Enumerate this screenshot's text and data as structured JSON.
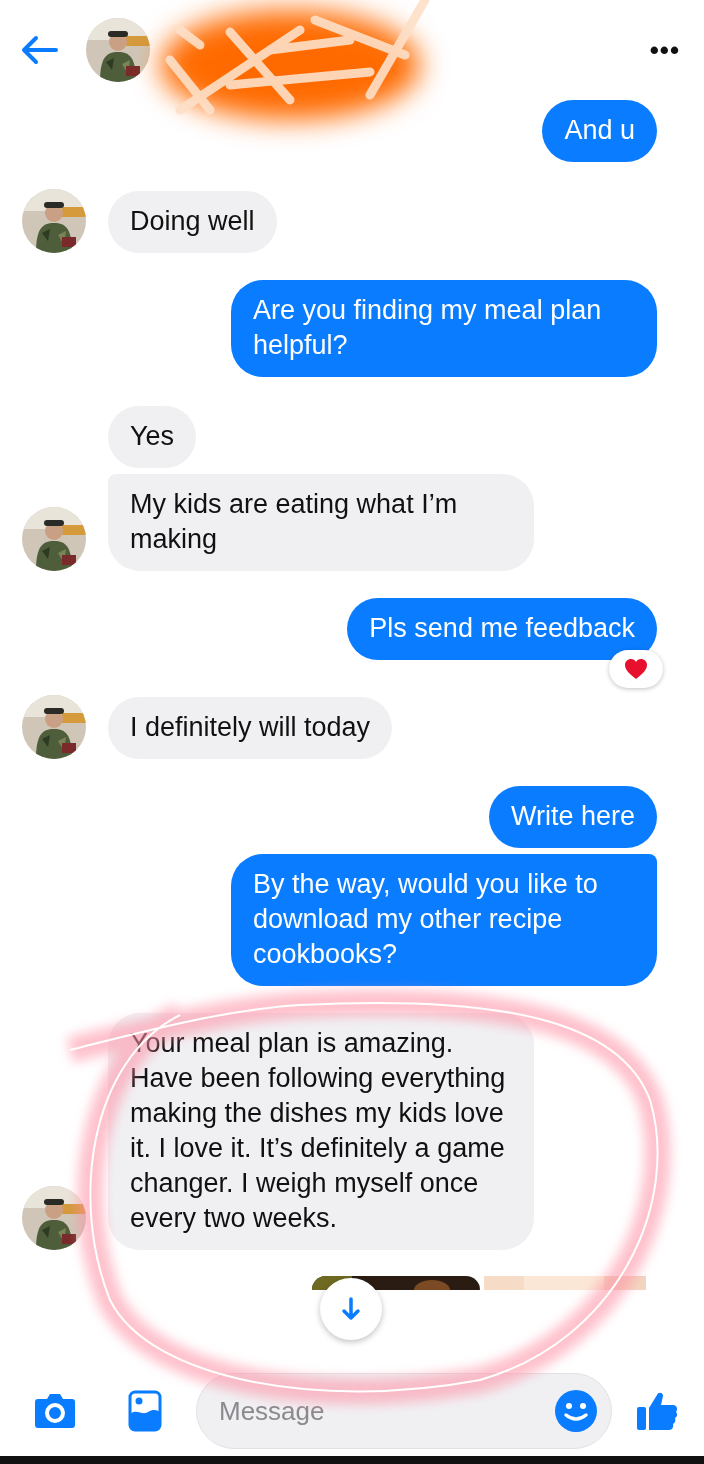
{
  "header": {
    "more_label": "•••"
  },
  "messages": [
    {
      "kind": "sent",
      "text": "And u",
      "grouped": false,
      "avatar": false,
      "hearted": false
    },
    {
      "kind": "received",
      "text": "Doing well",
      "grouped": false,
      "avatar": true,
      "hearted": false
    },
    {
      "kind": "sent",
      "text": "Are you finding my meal plan helpful?",
      "grouped": false,
      "avatar": false,
      "hearted": false
    },
    {
      "kind": "received",
      "text": "Yes",
      "grouped": false,
      "avatar": false,
      "hearted": false
    },
    {
      "kind": "received",
      "text": "My kids are eating what I’m making",
      "grouped": true,
      "avatar": true,
      "hearted": false
    },
    {
      "kind": "sent",
      "text": "Pls send me feedback",
      "grouped": false,
      "avatar": false,
      "hearted": true
    },
    {
      "kind": "received",
      "text": "I definitely will today",
      "grouped": false,
      "avatar": true,
      "hearted": false
    },
    {
      "kind": "sent",
      "text": "Write here",
      "grouped": false,
      "avatar": false,
      "hearted": false
    },
    {
      "kind": "sent",
      "text": "By the way, would you like to download my other recipe cookbooks?",
      "grouped": true,
      "avatar": false,
      "hearted": false
    },
    {
      "kind": "received",
      "text": "Your meal plan is amazing. Have been following everything making the dishes my kids love it. I love it. It’s definitely a game changer. I weigh myself once every two weeks.",
      "grouped": false,
      "avatar": true,
      "hearted": false
    }
  ],
  "composer": {
    "placeholder": "Message"
  }
}
